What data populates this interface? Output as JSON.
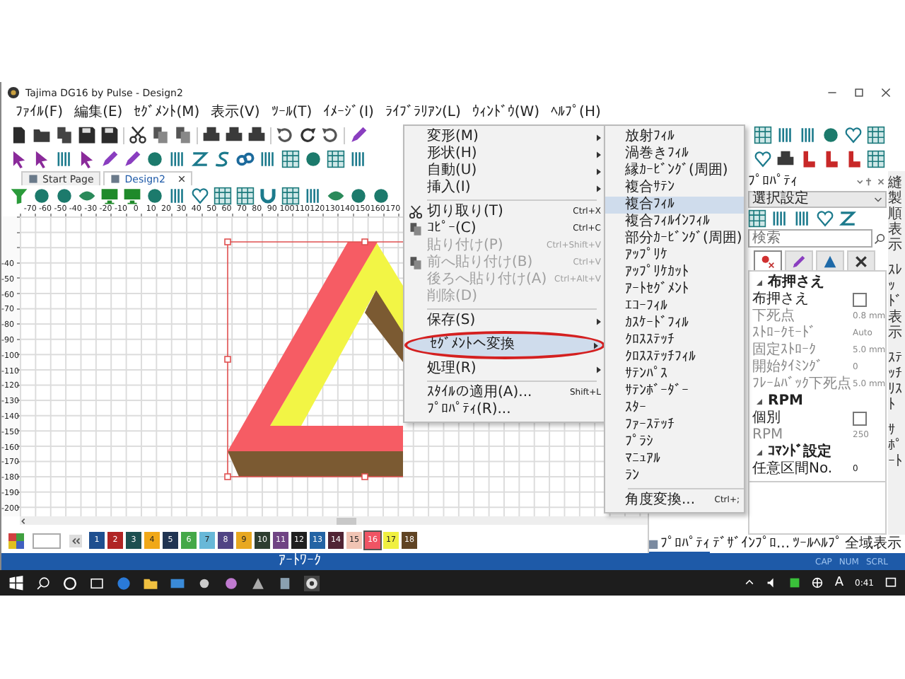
{
  "window": {
    "title": "Tajima DG16 by Pulse - Design2"
  },
  "menu_bar": [
    "ﾌｧｲﾙ(F)",
    "編集(E)",
    "ｾｸﾞﾒﾝﾄ(M)",
    "表示(V)",
    "ﾂｰﾙ(T)",
    "ｲﾒｰｼﾞ(I)",
    "ﾗｲﾌﾞﾗﾘｱﾝ(L)",
    "ｳｨﾝﾄﾞｳ(W)",
    "ﾍﾙﾌﾟ(H)"
  ],
  "document_tabs": [
    {
      "label": "Start Page",
      "selected": false
    },
    {
      "label": "Design2",
      "selected": true
    }
  ],
  "ruler": {
    "x_labels": [
      "-70",
      "-60",
      "-50",
      "-40",
      "-30",
      "-20",
      "-10",
      "0",
      "10",
      "20",
      "30",
      "40",
      "50",
      "60",
      "70",
      "80",
      "90",
      "100",
      "110",
      "120",
      "130",
      "140",
      "150",
      "160",
      "170"
    ],
    "y_labels": [
      "-40",
      "-50",
      "-60",
      "-70",
      "-80",
      "-90",
      "-100",
      "-110",
      "-120",
      "-130",
      "-140",
      "-150",
      "-160",
      "-170",
      "-180",
      "-190",
      "-200"
    ]
  },
  "palette": [
    {
      "label": "1",
      "color": "#1f4f8f",
      "selected": false
    },
    {
      "label": "2",
      "color": "#b02424",
      "selected": false
    },
    {
      "label": "3",
      "color": "#1d4f50",
      "selected": false
    },
    {
      "label": "4",
      "color": "#f0a818",
      "selected": false
    },
    {
      "label": "5",
      "color": "#203452",
      "selected": false
    },
    {
      "label": "6",
      "color": "#44a848",
      "selected": false
    },
    {
      "label": "7",
      "color": "#68b8d8",
      "selected": false
    },
    {
      "label": "8",
      "color": "#504484",
      "selected": false
    },
    {
      "label": "9",
      "color": "#e8a820",
      "selected": false
    },
    {
      "label": "10",
      "color": "#2e3e30",
      "selected": false
    },
    {
      "label": "11",
      "color": "#704484",
      "selected": false
    },
    {
      "label": "12",
      "color": "#202020",
      "selected": false
    },
    {
      "label": "13",
      "color": "#2464a4",
      "selected": false
    },
    {
      "label": "14",
      "color": "#502434",
      "selected": false
    },
    {
      "label": "15",
      "color": "#f0c4b4",
      "selected": false
    },
    {
      "label": "16",
      "color": "#f05464",
      "selected": true
    },
    {
      "label": "17",
      "color": "#f0f040",
      "selected": false
    },
    {
      "label": "18",
      "color": "#604424",
      "selected": false
    }
  ],
  "context_menu": {
    "items": [
      {
        "kind": "item",
        "label": "変形(M)",
        "submenu": true,
        "disabled": false,
        "selected": false,
        "circled": false
      },
      {
        "kind": "item",
        "label": "形状(H)",
        "submenu": true,
        "disabled": false,
        "selected": false,
        "circled": false
      },
      {
        "kind": "item",
        "label": "自動(U)",
        "submenu": true,
        "disabled": false,
        "selected": false,
        "circled": false
      },
      {
        "kind": "item",
        "label": "挿入(I)",
        "submenu": true,
        "disabled": false,
        "selected": false,
        "circled": false
      },
      {
        "kind": "separator"
      },
      {
        "kind": "item",
        "label": "切り取り(T)",
        "shortcut": "Ctrl+X",
        "submenu": false,
        "disabled": false,
        "selected": false,
        "circled": false
      },
      {
        "kind": "item",
        "label": "ｺﾋﾟｰ(C)",
        "shortcut": "Ctrl+C",
        "submenu": false,
        "disabled": false,
        "selected": false,
        "circled": false
      },
      {
        "kind": "item",
        "label": "貼り付け(P)",
        "shortcut": "Ctrl+Shift+V",
        "submenu": false,
        "disabled": true,
        "selected": false,
        "circled": false
      },
      {
        "kind": "item",
        "label": "前へ貼り付け(B)",
        "shortcut": "Ctrl+V",
        "submenu": false,
        "disabled": true,
        "selected": false,
        "circled": false
      },
      {
        "kind": "item",
        "label": "後ろへ貼り付け(A)",
        "shortcut": "Ctrl+Alt+V",
        "submenu": false,
        "disabled": true,
        "selected": false,
        "circled": false
      },
      {
        "kind": "item",
        "label": "削除(D)",
        "submenu": false,
        "disabled": true,
        "selected": false,
        "circled": false
      },
      {
        "kind": "separator"
      },
      {
        "kind": "item",
        "label": "保存(S)",
        "submenu": true,
        "disabled": false,
        "selected": false,
        "circled": false
      },
      {
        "kind": "item",
        "label": "ｾｸﾞﾒﾝﾄへ変換",
        "submenu": true,
        "disabled": false,
        "selected": true,
        "circled": true
      },
      {
        "kind": "item",
        "label": "処理(R)",
        "submenu": true,
        "disabled": false,
        "selected": false,
        "circled": false
      },
      {
        "kind": "separator"
      },
      {
        "kind": "item",
        "label": "ｽﾀｲﾙの適用(A)...",
        "shortcut": "Shift+L",
        "submenu": false,
        "disabled": false,
        "selected": false,
        "circled": false
      },
      {
        "kind": "item",
        "label": "ﾌﾟﾛﾊﾟﾃｨ(R)...",
        "submenu": false,
        "disabled": false,
        "selected": false,
        "circled": false
      }
    ]
  },
  "submenu": {
    "items": [
      {
        "kind": "item",
        "label": "放射ﾌｨﾙ",
        "selected": false
      },
      {
        "kind": "item",
        "label": "渦巻きﾌｨﾙ",
        "selected": false
      },
      {
        "kind": "item",
        "label": "縁ｶｰﾋﾞﾝｸﾞ(周囲)",
        "selected": false
      },
      {
        "kind": "item",
        "label": "複合ｻﾃﾝ",
        "selected": false
      },
      {
        "kind": "item",
        "label": "複合ﾌｨﾙ",
        "selected": true
      },
      {
        "kind": "item",
        "label": "複合ﾌｨﾙｲﾝﾌｨﾙ",
        "selected": false
      },
      {
        "kind": "item",
        "label": "部分ｶｰﾋﾞﾝｸﾞ(周囲)",
        "selected": false
      },
      {
        "kind": "item",
        "label": "ｱｯﾌﾟﾘｹ",
        "selected": false
      },
      {
        "kind": "item",
        "label": "ｱｯﾌﾟﾘｹｶｯﾄ",
        "selected": false
      },
      {
        "kind": "item",
        "label": "ｱｰﾄｾｸﾞﾒﾝﾄ",
        "selected": false
      },
      {
        "kind": "item",
        "label": "ｴｺｰﾌｨﾙ",
        "selected": false
      },
      {
        "kind": "item",
        "label": "ｶｽｹｰﾄﾞﾌｨﾙ",
        "selected": false
      },
      {
        "kind": "item",
        "label": "ｸﾛｽｽﾃｯﾁ",
        "selected": false
      },
      {
        "kind": "item",
        "label": "ｸﾛｽｽﾃｯﾁﾌｨﾙ",
        "selected": false
      },
      {
        "kind": "item",
        "label": "ｻﾃﾝﾊﾟｽ",
        "selected": false
      },
      {
        "kind": "item",
        "label": "ｻﾃﾝﾎﾞｰﾀﾞｰ",
        "selected": false
      },
      {
        "kind": "item",
        "label": "ｽﾀｰ",
        "selected": false
      },
      {
        "kind": "item",
        "label": "ﾌｧｰｽﾃｯﾁ",
        "selected": false
      },
      {
        "kind": "item",
        "label": "ﾌﾟﾗｼ",
        "selected": false
      },
      {
        "kind": "item",
        "label": "ﾏﾆｭｱﾙ",
        "selected": false
      },
      {
        "kind": "item",
        "label": "ﾗﾝ",
        "selected": false
      },
      {
        "kind": "separator"
      },
      {
        "kind": "item",
        "label": "角度変換...",
        "shortcut": "Ctrl+;",
        "selected": false
      }
    ]
  },
  "properties": {
    "title": "ﾌﾟﾛﾊﾟﾃｨ",
    "filter": "選択設定",
    "search": {
      "placeholder": "検索"
    },
    "tabs": [
      {
        "selected": true
      },
      {
        "selected": false
      },
      {
        "selected": false
      },
      {
        "selected": false
      }
    ],
    "groups": [
      {
        "title": "布押さえ",
        "expanded": true,
        "rows": [
          {
            "label": "布押さえ",
            "kind": "checkbox",
            "checked": false,
            "disabled": false
          },
          {
            "label": "下死点",
            "kind": "value",
            "value": "0.8 mm",
            "disabled": true
          },
          {
            "label": "ｽﾄﾛｰｸﾓｰﾄﾞ",
            "kind": "value",
            "value": "Auto",
            "disabled": true
          },
          {
            "label": "固定ｽﾄﾛｰｸ",
            "kind": "value",
            "value": "5.0 mm",
            "disabled": true
          },
          {
            "label": "開始ﾀｲﾐﾝｸﾞ",
            "kind": "value",
            "value": "0",
            "disabled": true
          },
          {
            "label": "ﾌﾚｰﾑﾊﾞｯｸ下死点",
            "kind": "value",
            "value": "5.0 mm",
            "disabled": true
          }
        ]
      },
      {
        "title": "RPM",
        "expanded": true,
        "rows": [
          {
            "label": "個別",
            "kind": "checkbox",
            "checked": false,
            "disabled": false
          },
          {
            "label": "RPM",
            "kind": "value",
            "value": "250",
            "disabled": true
          }
        ]
      },
      {
        "title": "ｺﾏﾝﾄﾞ設定",
        "expanded": true,
        "rows": [
          {
            "label": "任意区間No.",
            "kind": "value",
            "value": "0",
            "disabled": false
          }
        ]
      }
    ],
    "bottom_tabs": [
      {
        "label": "ﾌﾟﾛﾊﾟﾃｨ",
        "selected": true
      },
      {
        "label": "ﾃﾞｻﾞｲﾝﾌﾟﾛ...",
        "selected": false
      },
      {
        "label": "ﾂｰﾙﾍﾙﾌﾟ",
        "selected": false
      },
      {
        "label": "全域表示",
        "selected": false
      }
    ]
  },
  "side_tabs": [
    "縫製順表示",
    "ｽﾚｯﾄﾞ表示",
    "ｽﾃｯﾁﾘｽﾄ",
    "ｻﾎﾟｰﾄ"
  ],
  "status_bar": {
    "mode": "ｱｰﾄﾜｰｸ",
    "indicators": [
      "CAP",
      "NUM",
      "SCRL"
    ]
  },
  "taskbar": {
    "input_mode": "A",
    "time": "0:41"
  }
}
